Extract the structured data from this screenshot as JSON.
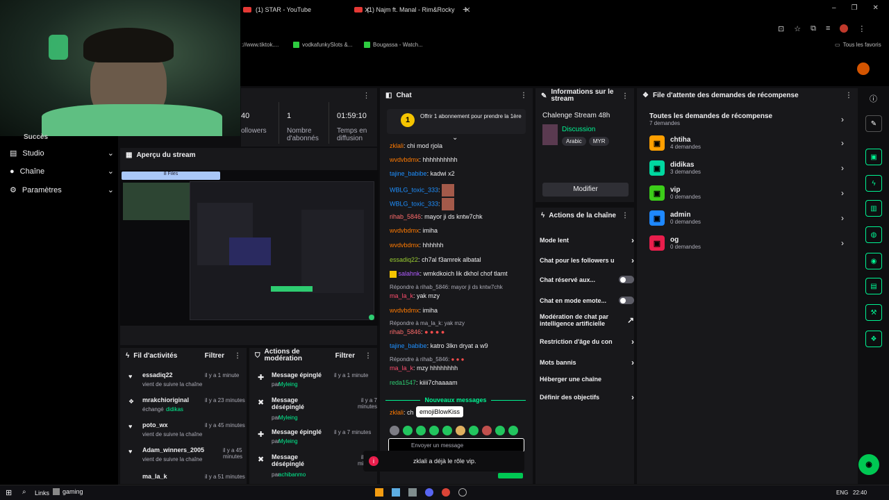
{
  "browser": {
    "tabs": [
      {
        "label": "(1) STAR - YouTube"
      },
      {
        "label": "(1) Najm ft. Manal - Rim&Rocky"
      }
    ],
    "new_tab": "+",
    "url_partial": "://www.tiktok....",
    "bookmarks": [
      "vodkafunkySlots &...",
      "Bougassa - Watch..."
    ],
    "bookmarks_all": "Tous les favoris",
    "window_controls": [
      "–",
      "❐",
      "✕"
    ]
  },
  "sidebar": {
    "partial_top": "Succès",
    "items": [
      {
        "label": "Studio",
        "icon": "studio-icon"
      },
      {
        "label": "Chaîne",
        "icon": "person-icon"
      },
      {
        "label": "Paramètres",
        "icon": "gear-icon"
      }
    ]
  },
  "stats": {
    "followers_value": "40",
    "followers_label": "ollowers",
    "subs_value": "1",
    "subs_label": "Nombre d'abonnés",
    "time_value": "01:59:10",
    "time_label": "Temps en diffusion"
  },
  "preview": {
    "title": "Aperçu du stream",
    "window_label": "8 Files"
  },
  "activity": {
    "title": "Fil d'activités",
    "filter": "Filtrer",
    "items": [
      {
        "user": "essadiq22",
        "text": "vient de suivre la chaîne",
        "time": "il y a 1 minute",
        "extra": ""
      },
      {
        "user": "mrakchioriginal",
        "text": "échangé",
        "extra": "didikas",
        "time": "il y a 23 minutes"
      },
      {
        "user": "poto_wx",
        "text": "vient de suivre la chaîne",
        "time": "il y a 45 minutes",
        "extra": ""
      },
      {
        "user": "Adam_winners_2005",
        "text": "vient de suivre la chaîne",
        "time": "il y a 45 minutes",
        "extra": ""
      },
      {
        "user": "ma_la_k",
        "text": "",
        "time": "il y a 51 minutes",
        "extra": ""
      }
    ]
  },
  "moderation": {
    "title": "Actions de modération",
    "filter": "Filtrer",
    "items": [
      {
        "action": "Message épinglé",
        "by": "par",
        "user": "Myleing",
        "time": "il y a 1 minute"
      },
      {
        "action": "Message désépinglé",
        "by": "par",
        "user": "Myleing",
        "time": "il y a 7 minutes"
      },
      {
        "action": "Message épinglé",
        "by": "par",
        "user": "Myleing",
        "time": "il y a 7 minutes"
      },
      {
        "action": "Message désépinglé",
        "by": "par",
        "user": "achibanmo",
        "time": "il y a 7 minutes"
      }
    ]
  },
  "chat": {
    "title": "Chat",
    "pinned_badge": "1",
    "pinned_text": "Offrir 1 abonnement pour prendre la 1ère",
    "messages": [
      {
        "user": "zklali",
        "text": "chi mod rjola",
        "cls": "u1"
      },
      {
        "user": "wvdvbdmx",
        "text": "hhhhhhhhhh",
        "cls": "u1"
      },
      {
        "user": "tajine_babibe",
        "text": "kadwi x2",
        "cls": "u3"
      },
      {
        "user": "WBLG_toxic_333",
        "text": "",
        "cls": "u3"
      },
      {
        "user": "WBLG_toxic_333",
        "text": "",
        "cls": "u3"
      },
      {
        "user": "rihab_5846",
        "text": "mayor ji ds kntw7chk",
        "cls": "u2"
      },
      {
        "user": "wvdvbdmx",
        "text": "imiha",
        "cls": "u1"
      },
      {
        "user": "wvdvbdmx",
        "text": "hhhhhh",
        "cls": "u1"
      },
      {
        "user": "essadiq22",
        "text": "ch7al f3amrek albatal",
        "cls": "u4"
      },
      {
        "user": "salahnk",
        "text": "wmkdkoich lik dkhol chof tlamt",
        "cls": "u5"
      },
      {
        "user": "ma_la_k",
        "text": "yak mzy",
        "cls": "u7",
        "reply": "Répondre à rihab_5846: mayor ji ds kntw7chk"
      },
      {
        "user": "wvdvbdmx",
        "text": "imiha",
        "cls": "u1"
      },
      {
        "user": "rihab_5846",
        "text": "",
        "cls": "u2",
        "reply": "Répondre à ma_la_k: yak mzy"
      },
      {
        "user": "tajine_babibe",
        "text": "katro 3lkn dryat a w9",
        "cls": "u3"
      },
      {
        "user": "ma_la_k",
        "text": "mzy hhhhhhhh",
        "cls": "u7",
        "reply": "Répondre à rihab_5846:"
      },
      {
        "user": "reda1547",
        "text": "kiiii7chaaaam",
        "cls": "u6"
      }
    ],
    "new_messages": "Nouveaux messages",
    "last_user": "zklali",
    "last_text": "ch",
    "tooltip": "emojiBlowKiss",
    "input_placeholder": "Envoyer un message",
    "toast": "zklali a déjà le rôle vip."
  },
  "stream_info": {
    "title": "Informations sur le stream",
    "stream_title": "Chalenge Stream 48h",
    "category": "Discussion",
    "tags": [
      "Arabic",
      "MYR"
    ],
    "edit": "Modifier"
  },
  "channel_actions": {
    "title": "Actions de la chaîne",
    "items": [
      {
        "label": "Mode lent",
        "kind": "chev"
      },
      {
        "label": "Chat pour les followers u",
        "kind": "chev"
      },
      {
        "label": "Chat réservé aux...",
        "kind": "toggle"
      },
      {
        "label": "Chat en mode emote...",
        "kind": "toggle"
      },
      {
        "label": "Modération de chat par intelligence artificielle",
        "kind": "ext"
      },
      {
        "label": "Restriction d'âge du con",
        "kind": "chev"
      },
      {
        "label": "Mots bannis",
        "kind": "chev"
      },
      {
        "label": "Héberger une chaîne",
        "kind": "none"
      },
      {
        "label": "Définir des objectifs",
        "kind": "chev"
      }
    ]
  },
  "rewards": {
    "title": "File d'attente des demandes de récompense",
    "all_label": "Toutes les demandes de récompense",
    "all_count": "7 demandes",
    "items": [
      {
        "name": "chtiha",
        "count": "4 demandes",
        "color": "#ff9f00"
      },
      {
        "name": "didikas",
        "count": "3 demandes",
        "color": "#00d8a0"
      },
      {
        "name": "vip",
        "count": "0 demandes",
        "color": "#3ccd19"
      },
      {
        "name": "admin",
        "count": "0 demandes",
        "color": "#1e88ff"
      },
      {
        "name": "og",
        "count": "0 demandes",
        "color": "#e91e4c"
      }
    ]
  },
  "taskbar": {
    "links": "Links",
    "gaming": "gaming",
    "lang": "ENG",
    "time": "22:40"
  }
}
